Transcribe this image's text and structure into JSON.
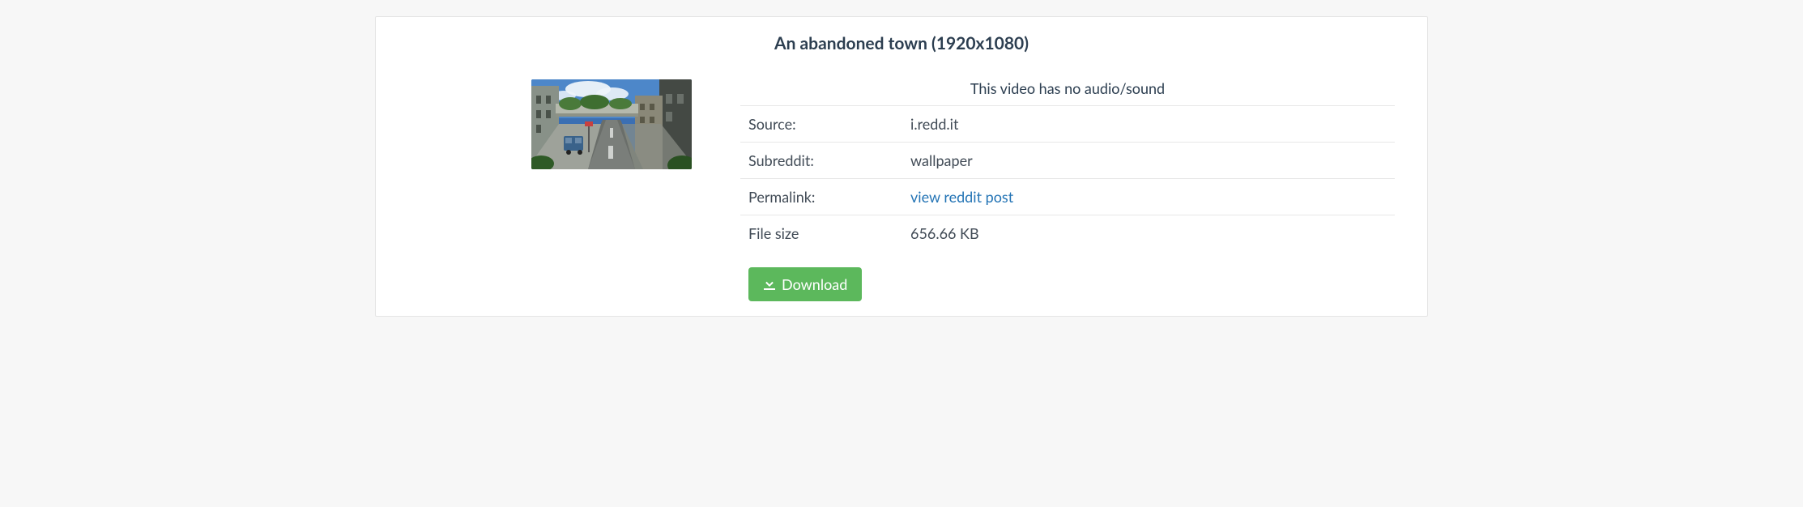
{
  "title": "An abandoned town (1920x1080)",
  "notice": "This video has no audio/sound",
  "rows": {
    "source": {
      "label": "Source:",
      "value": "i.redd.it"
    },
    "subreddit": {
      "label": "Subreddit:",
      "value": "wallpaper"
    },
    "permalink": {
      "label": "Permalink:",
      "link_text": "view reddit post"
    },
    "filesize": {
      "label": "File size",
      "value": "656.66 KB"
    }
  },
  "download_label": "Download"
}
